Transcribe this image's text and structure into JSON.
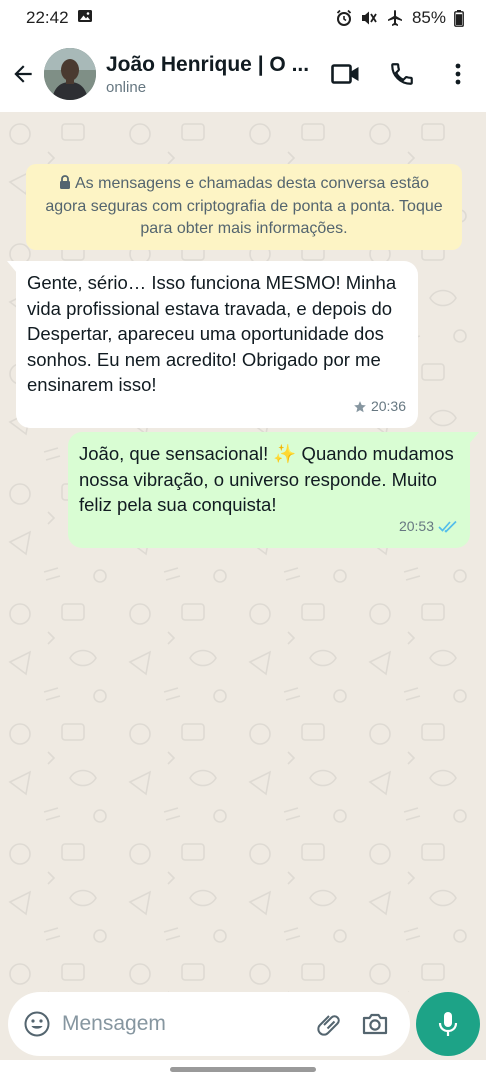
{
  "status_bar": {
    "time": "22:42",
    "battery": "85%",
    "icons": [
      "gallery-notification-icon",
      "alarm-icon",
      "mute-icon",
      "airplane-mode-icon",
      "battery-icon"
    ]
  },
  "header": {
    "contact_name": "João Henrique | O ...",
    "presence": "online",
    "actions": [
      "video-call-icon",
      "voice-call-icon",
      "more-options-icon"
    ]
  },
  "encryption_notice": {
    "text": "As mensagens e chamadas desta conversa estão agora seguras com criptografia de ponta a ponta. Toque para obter mais informações."
  },
  "messages": [
    {
      "direction": "incoming",
      "text": "Gente, sério… Isso funciona MESMO! Minha vida profissional estava travada, e depois do Despertar, apareceu uma oportunidade dos sonhos. Eu nem acredito! Obrigado por me ensinarem isso!",
      "time": "20:36",
      "starred": true
    },
    {
      "direction": "outgoing",
      "text": "João, que sensacional! ✨ Quando mudamos nossa vibração, o universo responde. Muito feliz pela sua conquista!",
      "time": "20:53",
      "read": true
    }
  ],
  "composer": {
    "placeholder": "Mensagem"
  },
  "colors": {
    "chat_background": "#efeae2",
    "outgoing_bubble": "#d9fdd3",
    "incoming_bubble": "#ffffff",
    "encryption_banner": "#fdf4c5",
    "accent": "#1da387",
    "read_ticks": "#53bdeb"
  }
}
